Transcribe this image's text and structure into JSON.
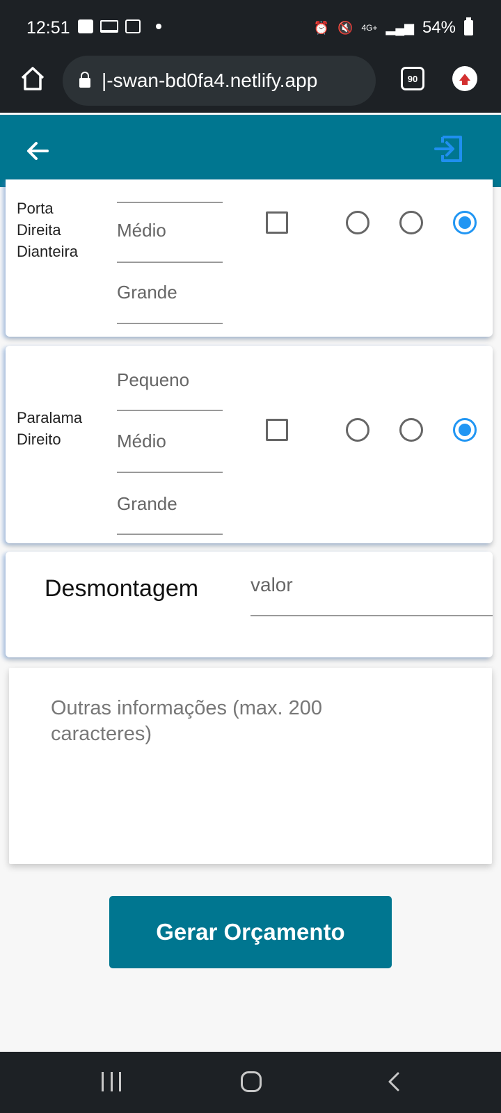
{
  "status": {
    "time": "12:51",
    "network": "4G+",
    "battery": "54%"
  },
  "browser": {
    "url": "|-swan-bd0fa4.netlify.app",
    "tab_count": "90"
  },
  "parts": [
    {
      "label": "Porta\nDireita\nDianteira",
      "sizes": [
        "Médio",
        "Grande"
      ],
      "checked": false,
      "selected_radio": 3
    },
    {
      "label": "Paralama\nDireito",
      "sizes": [
        "Pequeno",
        "Médio",
        "Grande"
      ],
      "checked": false,
      "selected_radio": 3
    }
  ],
  "desmontagem": {
    "label": "Desmontagem",
    "value_placeholder": "valor"
  },
  "other_info": {
    "placeholder": "Outras informações (max. 200 caracteres)"
  },
  "actions": {
    "submit_label": "Gerar Orçamento"
  },
  "colors": {
    "app_bar": "#007690",
    "radio_selected": "#2196f3",
    "system_bar": "#1d2125"
  }
}
